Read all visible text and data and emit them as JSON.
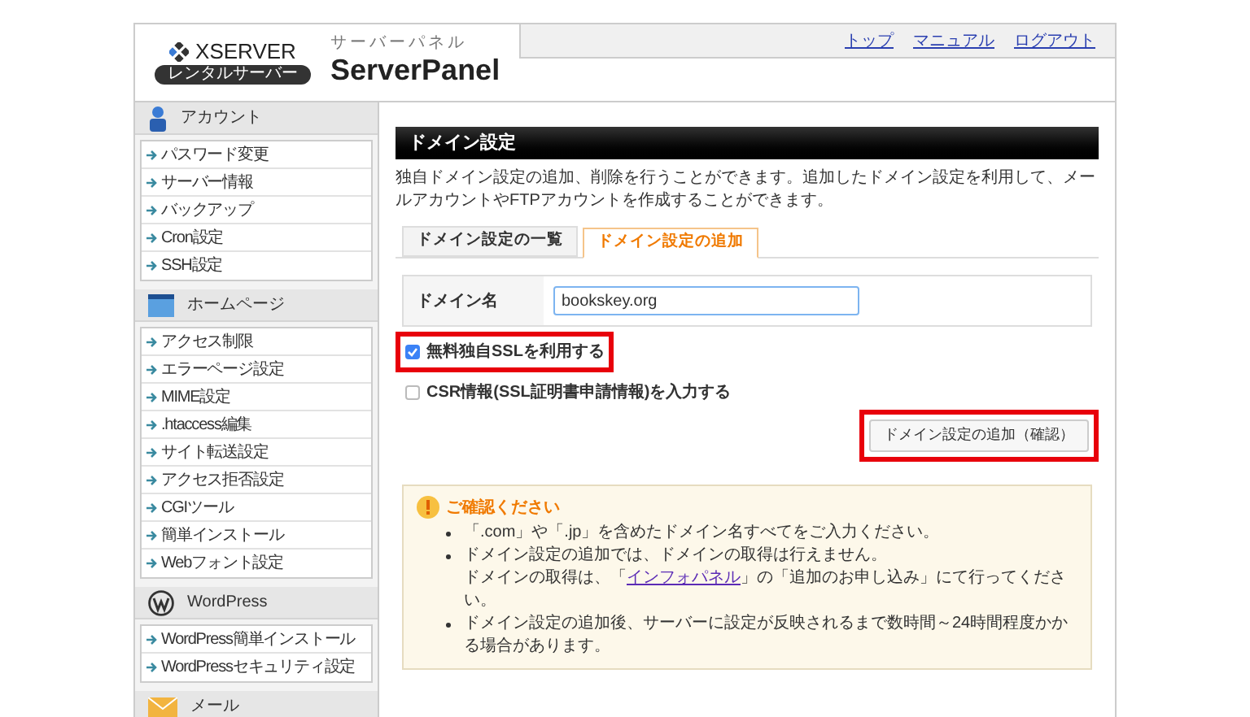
{
  "header": {
    "brand": "XSERVER",
    "brand_badge": "レンタルサーバー",
    "panel_kana": "サーバーパネル",
    "panel_title": "ServerPanel",
    "links": [
      "トップ",
      "マニュアル",
      "ログアウト"
    ]
  },
  "sidebar": [
    {
      "kind": "account",
      "title": "アカウント",
      "items": [
        "パスワード変更",
        "サーバー情報",
        "バックアップ",
        "Cron設定",
        "SSH設定"
      ]
    },
    {
      "kind": "homepage",
      "title": "ホームページ",
      "items": [
        "アクセス制限",
        "エラーページ設定",
        "MIME設定",
        ".htaccess編集",
        "サイト転送設定",
        "アクセス拒否設定",
        "CGIツール",
        "簡単インストール",
        "Webフォント設定"
      ]
    },
    {
      "kind": "wordpress",
      "title": "WordPress",
      "items": [
        "WordPress簡単インストール",
        "WordPressセキュリティ設定"
      ]
    },
    {
      "kind": "mail",
      "title": "メール"
    }
  ],
  "main": {
    "title": "ドメイン設定",
    "description": "独自ドメイン設定の追加、削除を行うことができます。追加したドメイン設定を利用して、メールアカウントやFTPアカウントを作成することができます。",
    "tabs": [
      {
        "label": "ドメイン設定の一覧",
        "selected": false
      },
      {
        "label": "ドメイン設定の追加",
        "selected": true
      }
    ],
    "form": {
      "label": "ドメイン名",
      "value": "bookskey.org"
    },
    "options": [
      {
        "label": "無料独自SSLを利用する",
        "checked": true,
        "highlighted": true
      },
      {
        "label": "CSR情報(SSL証明書申請情報)を入力する",
        "checked": false,
        "highlighted": false
      }
    ],
    "submit": {
      "label": "ドメイン設定の追加（確認）",
      "highlighted": true
    },
    "notice": {
      "title": "ご確認ください",
      "items": [
        {
          "lines": [
            "「.com」や「.jp」を含めたドメイン名すべてをご入力ください。"
          ]
        },
        {
          "lines": [
            "ドメイン設定の追加では、ドメインの取得は行えません。"
          ],
          "before_link": "ドメインの取得は、「",
          "link": "インフォパネル",
          "after_link": "」の「追加のお申し込み」にて行ってください。"
        },
        {
          "lines": [
            "ドメイン設定の追加後、サーバーに設定が反映されるまで数時間～24時間程度かかる場合があります。"
          ]
        }
      ]
    }
  }
}
